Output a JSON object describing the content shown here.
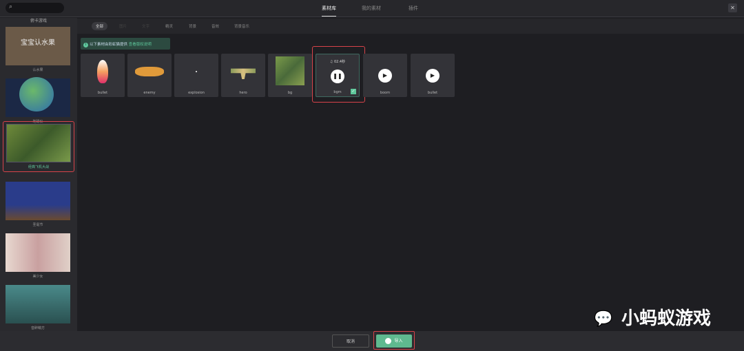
{
  "search": {
    "icon": "search-icon",
    "placeholder": ""
  },
  "tabs": [
    "素材库",
    "我的素材",
    "插件"
  ],
  "close_label": "✕",
  "sidebar": {
    "top_partial": "俯卡游戏",
    "items": [
      {
        "label": "认水果",
        "title": "宝宝认水果"
      },
      {
        "label": "地球仪"
      },
      {
        "label": "经典飞机大战"
      },
      {
        "label": "圣诞节"
      },
      {
        "label": "美少女"
      },
      {
        "label": "音醉萌方"
      }
    ]
  },
  "filters": [
    "全部",
    "图片",
    "文字",
    "精灵",
    "背景",
    "音效",
    "背景音乐"
  ],
  "notice": {
    "text": "以下素材由彩虹猫提供",
    "link": "查看版权说明"
  },
  "assets": [
    {
      "name": "bullet",
      "type": "image"
    },
    {
      "name": "enemy",
      "type": "image"
    },
    {
      "name": "explosion",
      "type": "image"
    },
    {
      "name": "hero",
      "type": "image"
    },
    {
      "name": "bg",
      "type": "image"
    },
    {
      "name": "bgm",
      "type": "audio",
      "duration": "02.4秒",
      "selected": true,
      "playing": true
    },
    {
      "name": "boom",
      "type": "audio"
    },
    {
      "name": "bullet",
      "type": "audio"
    }
  ],
  "buttons": {
    "cancel": "取消",
    "import": "导入"
  },
  "watermark": "小蚂蚁游戏"
}
